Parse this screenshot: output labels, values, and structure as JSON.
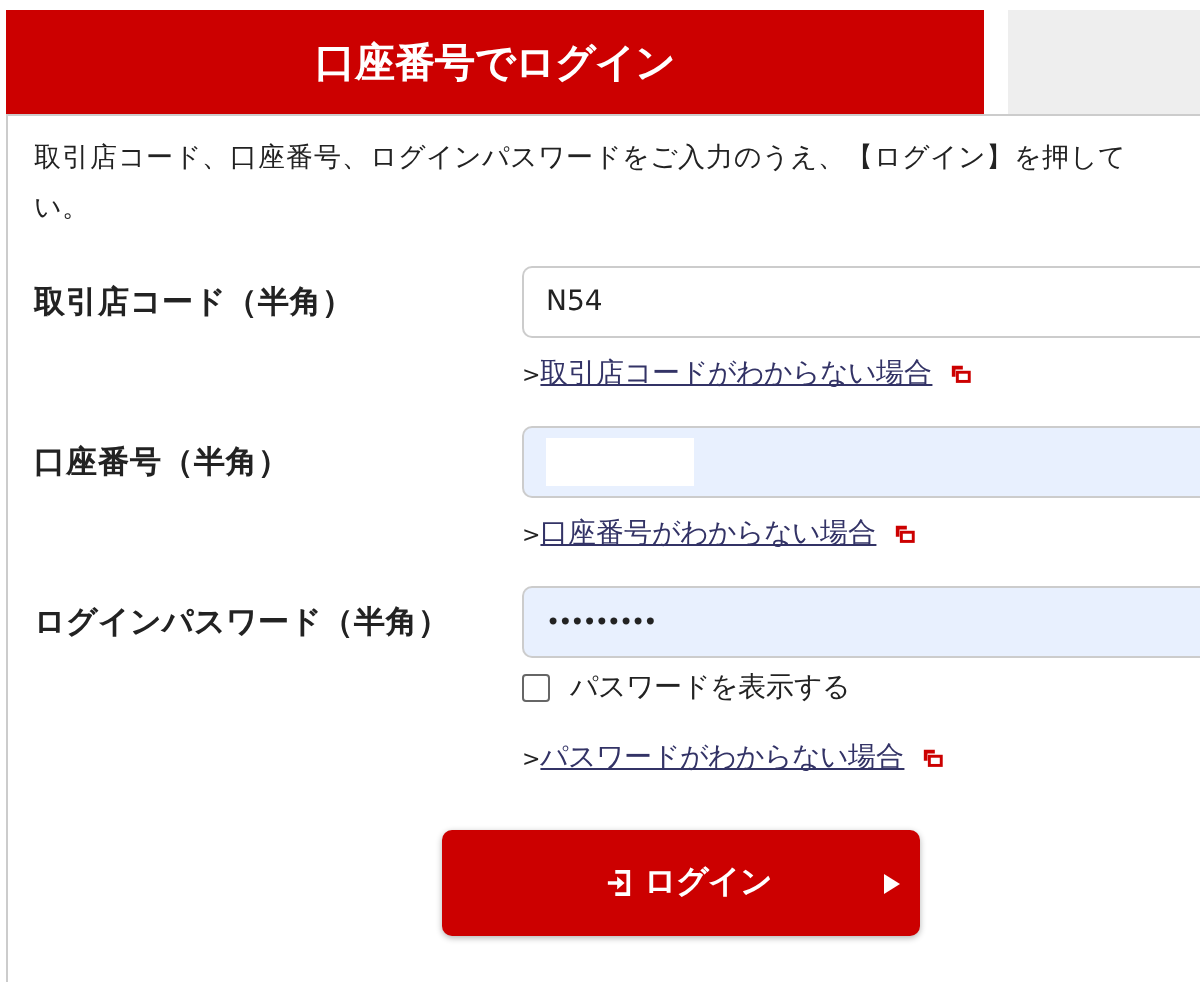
{
  "tabs": [
    {
      "label": "口座番号でログイン",
      "selected": true
    },
    {
      "selected": false
    }
  ],
  "intro": [
    "取引店コード、口座番号、ログインパスワードをご入力のうえ、【ログイン】を押して",
    "い。"
  ],
  "fields": [
    {
      "label": "取引店コード（半角）",
      "kind": "text",
      "value": "N54",
      "autofilled": false,
      "masked": false,
      "link": "取引店コードがわからない場合"
    },
    {
      "label": "口座番号（半角）",
      "kind": "text",
      "autofilled": true,
      "masked": true,
      "link": "口座番号がわからない場合"
    },
    {
      "label": "ログインパスワード（半角）",
      "kind": "password",
      "value": "•••••••••",
      "autofilled": true,
      "masked": false,
      "show_password": {
        "label": "パスワードを表示する",
        "checked": false
      },
      "link": "パスワードがわからない場合"
    }
  ],
  "link_prefix": ">",
  "login_button": {
    "label": "ログイン"
  }
}
